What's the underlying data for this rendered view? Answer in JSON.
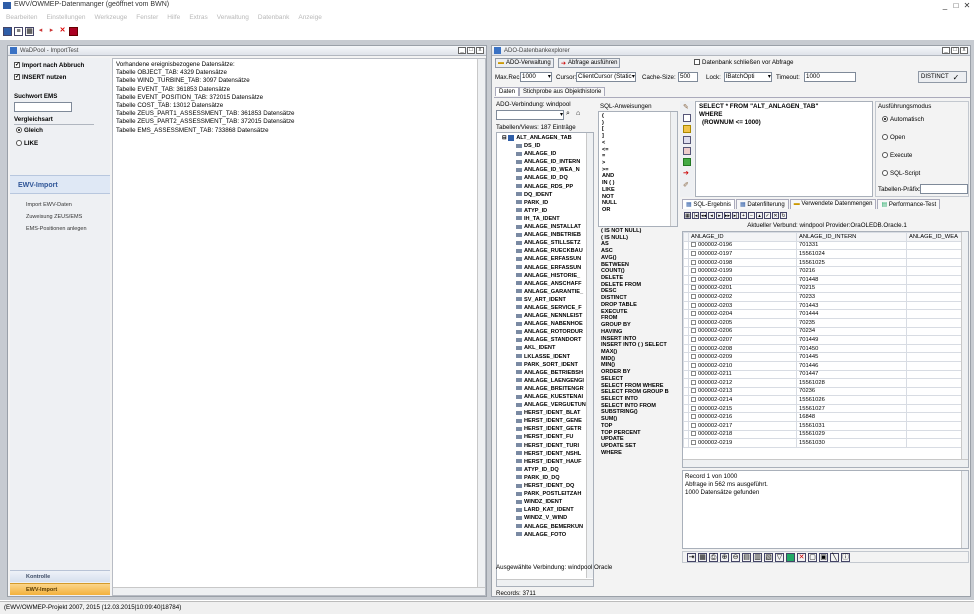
{
  "window": {
    "title": "EWV/OWMEP-Datenmanger (geöffnet vom BWN)",
    "min": "_",
    "max": "□",
    "close": "✕"
  },
  "menu": [
    "Bearbeiten",
    "Einstellungen",
    "Werkzeuge",
    "Fenster",
    "Hilfe",
    "Extras",
    "Verwaltung",
    "Datenbank",
    "Anzeige"
  ],
  "toolbar": {
    "icons": [
      "save-icon",
      "list-icon",
      "grid-icon",
      "arrow-left-icon",
      "arrow-right-icon",
      "delete-icon",
      "stop-icon"
    ]
  },
  "wadpool": {
    "title": "WaDPool - ImportTest",
    "import_nach_abbruch": "Import nach Abbruch",
    "insert_nutzen": "INSERT nutzen",
    "suchwort_label": "Suchwort EMS",
    "vergleichsart_label": "Vergleichsart",
    "gleich": "Gleich",
    "like": "LIKE",
    "ewv_import": "EWV-Import",
    "nav": [
      "Import EWV-Daten",
      "Zuweisung ZEUS/EMS",
      "EMS-Positionen anlegen"
    ],
    "bottom_tabs": [
      "Kontrolle",
      "EWV-Import"
    ],
    "log": [
      "Vorhandene ereignisbezogene Datensätze:",
      "Tabelle OBJECT_TAB: 4329 Datensätze",
      "Tabelle WIND_TURBINE_TAB: 3097 Datensätze",
      "Tabelle EVENT_TAB: 361853 Datensätze",
      "Tabelle EVENT_POSITION_TAB: 372015 Datensätze",
      "Tabelle COST_TAB: 13012 Datensätze",
      "Tabelle ZEUS_PART1_ASSESSMENT_TAB: 361853 Datensätze",
      "Tabelle ZEUS_PART2_ASSESSMENT_TAB: 372015 Datensätze",
      "Tabelle EMS_ASSESSMENT_TAB: 733868 Datensätze"
    ]
  },
  "ado": {
    "title": "ADO-Datenbankexplorer",
    "ado_verwaltung": "ADO-Verwaltung",
    "abfrage_ausfuehren": "Abfrage ausführen",
    "db_schliessen": "Datenbank schließen vor Abfrage",
    "maxrec_label": "Max.Rec.:",
    "maxrec_val": "1000",
    "cursor_label": "Cursor:",
    "cursor_val": "ClientCursor (Static",
    "cache_label": "Cache-Size:",
    "cache_val": "500",
    "lock_label": "Lock:",
    "lock_val": "lBatchOpti",
    "timeout_label": "Timeout:",
    "timeout_val": "1000",
    "distinct": "DISTINCT",
    "tab_daten": "Daten",
    "tab_stich": "Stichprobe aus Objekthistorie",
    "verbindung_label": "ADO-Verbindung: windpool",
    "sql_anw_label": "SQL-Anweisungen",
    "tables_label": "Tabellen/Views: 187 Einträge",
    "tree": [
      "ALT_ANLAGEN_TAB",
      "DS_ID",
      "ANLAGE_ID",
      "ANLAGE_ID_INTERN",
      "ANLAGE_ID_WEA_N",
      "ANLAGE_ID_DQ",
      "ANLAGE_RDS_PP",
      "DQ_IDENT",
      "PARK_ID",
      "ATYP_ID",
      "IH_TA_IDENT",
      "ANLAGE_INSTALLAT",
      "ANLAGE_INBETRIEB",
      "ANLAGE_STILLSETZ",
      "ANLAGE_RUECKBAU",
      "ANLAGE_ERFASSUN",
      "ANLAGE_ERFASSUN",
      "ANLAGE_HISTORIE_",
      "ANLAGE_ANSCHAFF",
      "ANLAGE_GARANTIE_",
      "SV_ART_IDENT",
      "ANLAGE_SERVICE_F",
      "ANLAGE_NENNLEIST",
      "ANLAGE_NABENHOE",
      "ANLAGE_ROTORDUR",
      "ANLAGE_STANDORT",
      "AKL_IDENT",
      "LKLASSE_IDENT",
      "PARK_SORT_IDENT",
      "ANLAGE_BETRIEBSH",
      "ANLAGE_LAENGENGI",
      "ANLAGE_BREITENGR",
      "ANLAGE_KUESTENAI",
      "ANLAGE_VERGUETUN",
      "HERST_IDENT_BLAT",
      "HERST_IDENT_GENE",
      "HERST_IDENT_GETR",
      "HERST_IDENT_FU",
      "HERST_IDENT_TURI",
      "HERST_IDENT_NSHL",
      "HERST_IDENT_HAUF",
      "ATYP_ID_DQ",
      "PARK_ID_DQ",
      "HERST_IDENT_DQ",
      "PARK_POSTLEITZAH",
      "WINDZ_IDENT",
      "LARD_KAT_IDENT",
      "WINDZ_V_WIND",
      "ANLAGE_BEMERKUN",
      "ANLAGE_FOTO"
    ],
    "records": "Records: 3711",
    "keywords": [
      "(",
      ")",
      "[",
      "]",
      "<",
      "<=",
      "=",
      ">",
      ">=",
      "AND",
      "IN ( )",
      "LIKE",
      "NOT",
      "NULL",
      "OR",
      "( IS NOT NULL)",
      "( IS NULL)",
      "AS",
      "ASC",
      "AVG()",
      "BETWEEN",
      "COUNT()",
      "DELETE",
      "DELETE FROM",
      "DESC",
      "DISTINCT",
      "DROP TABLE",
      "EXECUTE",
      "FROM",
      "GROUP BY",
      "HAVING",
      "INSERT INTO",
      "INSERT INTO ( ) SELECT",
      "MAX()",
      "MID()",
      "MIN()",
      "ORDER BY",
      "SELECT",
      "SELECT FROM WHERE",
      "SELECT FROM GROUP B",
      "SELECT INTO",
      "SELECT INTO FROM",
      "SUBSTRING()",
      "SUM()",
      "TOP",
      "TOP PERCENT",
      "UPDATE",
      "UPDATE SET",
      "WHERE"
    ],
    "sql": [
      "SELECT * FROM \"ALT_ANLAGEN_TAB\"",
      "WHERE",
      "(ROWNUM <= 1000)"
    ],
    "ausfuehrung_label": "Ausführungsmodus",
    "modes": [
      "Automatisch",
      "Open",
      "Execute",
      "SQL-Script"
    ],
    "tabellen_praefix": "Tabellen-Präfix:",
    "result_tabs": [
      "SQL-Ergebnis",
      "Datenfilterung",
      "Verwendete Datenmengen",
      "Performance-Test"
    ],
    "verbund": "Aktueller Verbund: windpool Provider:OraOLEDB.Oracle.1",
    "columns": [
      "ANLAGE_ID",
      "ANLAGE_ID_INTERN",
      "ANLAGE_ID_WEA"
    ],
    "rows": [
      [
        "000002-0196",
        "701331"
      ],
      [
        "000002-0197",
        "15561024"
      ],
      [
        "000002-0198",
        "15561025"
      ],
      [
        "000002-0199",
        "70216"
      ],
      [
        "000002-0200",
        "701448"
      ],
      [
        "000002-0201",
        "70215"
      ],
      [
        "000002-0202",
        "70233"
      ],
      [
        "000002-0203",
        "701443"
      ],
      [
        "000002-0204",
        "701444"
      ],
      [
        "000002-0205",
        "70235"
      ],
      [
        "000002-0206",
        "70234"
      ],
      [
        "000002-0207",
        "701449"
      ],
      [
        "000002-0208",
        "701450"
      ],
      [
        "000002-0209",
        "701445"
      ],
      [
        "000002-0210",
        "701446"
      ],
      [
        "000002-0211",
        "701447"
      ],
      [
        "000002-0212",
        "15561028"
      ],
      [
        "000002-0213",
        "70236"
      ],
      [
        "000002-0214",
        "15561026"
      ],
      [
        "000002-0215",
        "15561027"
      ],
      [
        "000002-0216",
        "16848"
      ],
      [
        "000002-0217",
        "15561031"
      ],
      [
        "000002-0218",
        "15561029"
      ],
      [
        "000002-0219",
        "15561030"
      ]
    ],
    "msg": [
      "Record 1 von 1000",
      "Abfrage in 562 ms ausgeführt.",
      "1000 Datensätze gefunden"
    ],
    "verbindung_bottom": "Ausgewählte Verbindung: windpool   Oracle"
  },
  "statusbar": "(EWV/OWMEP-Projekt 2007, 2015 (12.03.2015|10:09:40|18784)"
}
